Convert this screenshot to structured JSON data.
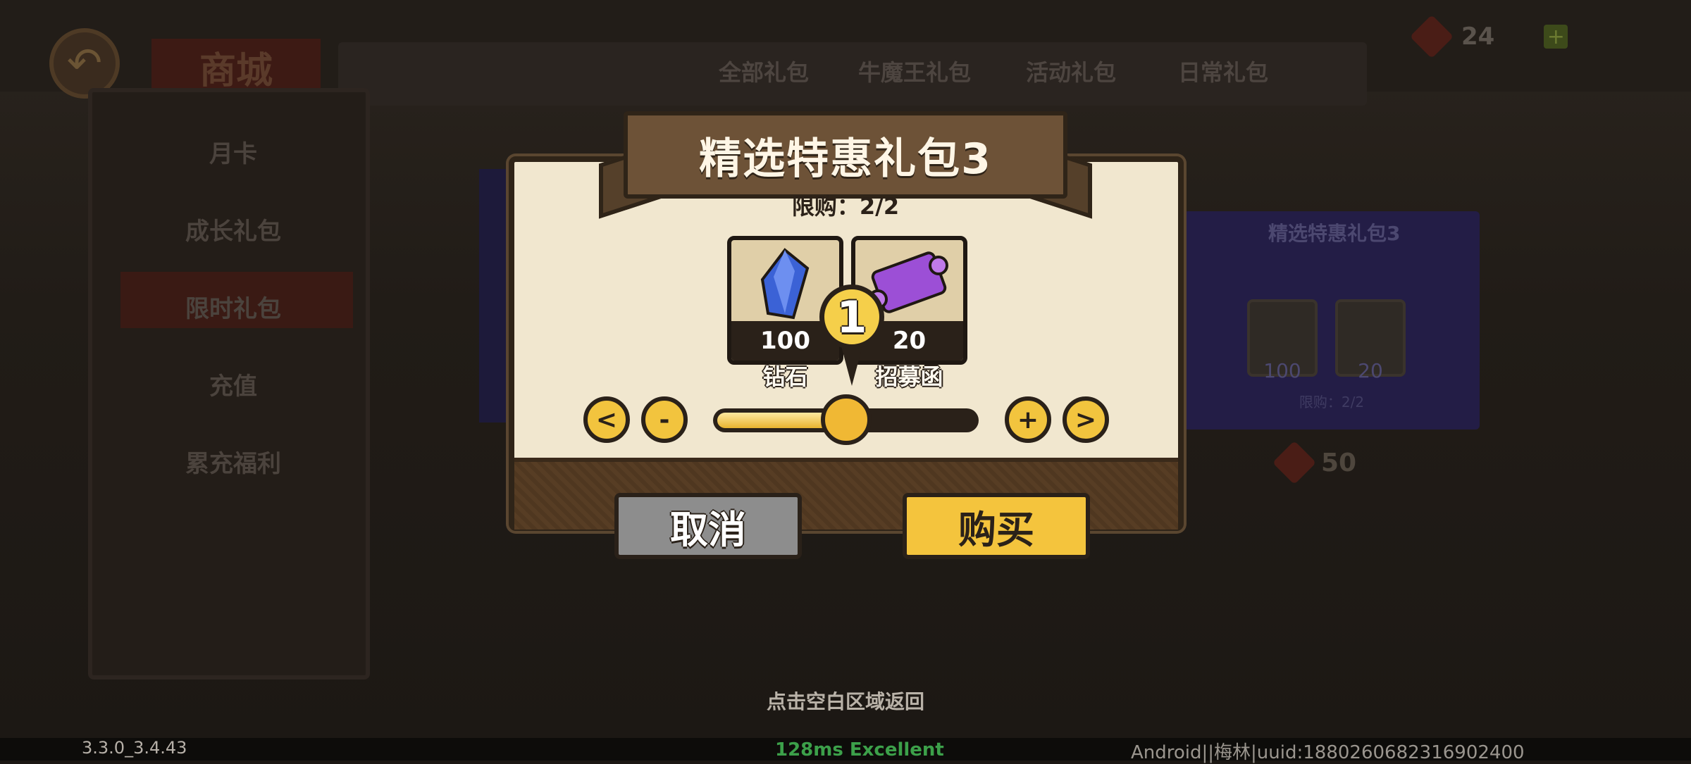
{
  "background": {
    "shop_title": "商城",
    "tabs": [
      "全部礼包",
      "牛魔王礼包",
      "活动礼包",
      "日常礼包"
    ],
    "currency_value": "24",
    "sidebar": [
      "月卡",
      "成长礼包",
      "限时礼包",
      "充值",
      "累充福利"
    ],
    "card_title": "精选特惠礼包3",
    "card_items": [
      "100",
      "20"
    ],
    "card_limit": "限购：2/2",
    "card_price": "50"
  },
  "modal": {
    "title": "精选特惠礼包3",
    "limit": "限购：2/2",
    "items": [
      {
        "name": "钻石",
        "qty": "100",
        "icon": "diamond-icon"
      },
      {
        "name": "招募函",
        "qty": "20",
        "icon": "scroll-icon"
      }
    ],
    "quantity": "1",
    "slider_fraction": 0.5,
    "buttons": {
      "prev": "<",
      "minus": "-",
      "plus": "+",
      "next": ">",
      "cancel": "取消",
      "buy": "购买"
    }
  },
  "hint": "点击空白区域返回",
  "status": {
    "version": "3.3.0_3.4.43",
    "ping": "128ms Excellent",
    "device": "Android||梅林|uuid:1880260682316902400"
  },
  "colors": {
    "accent_gold": "#f4c43d",
    "parchment": "#f1e7cf",
    "ping_green": "#3ca04a"
  }
}
